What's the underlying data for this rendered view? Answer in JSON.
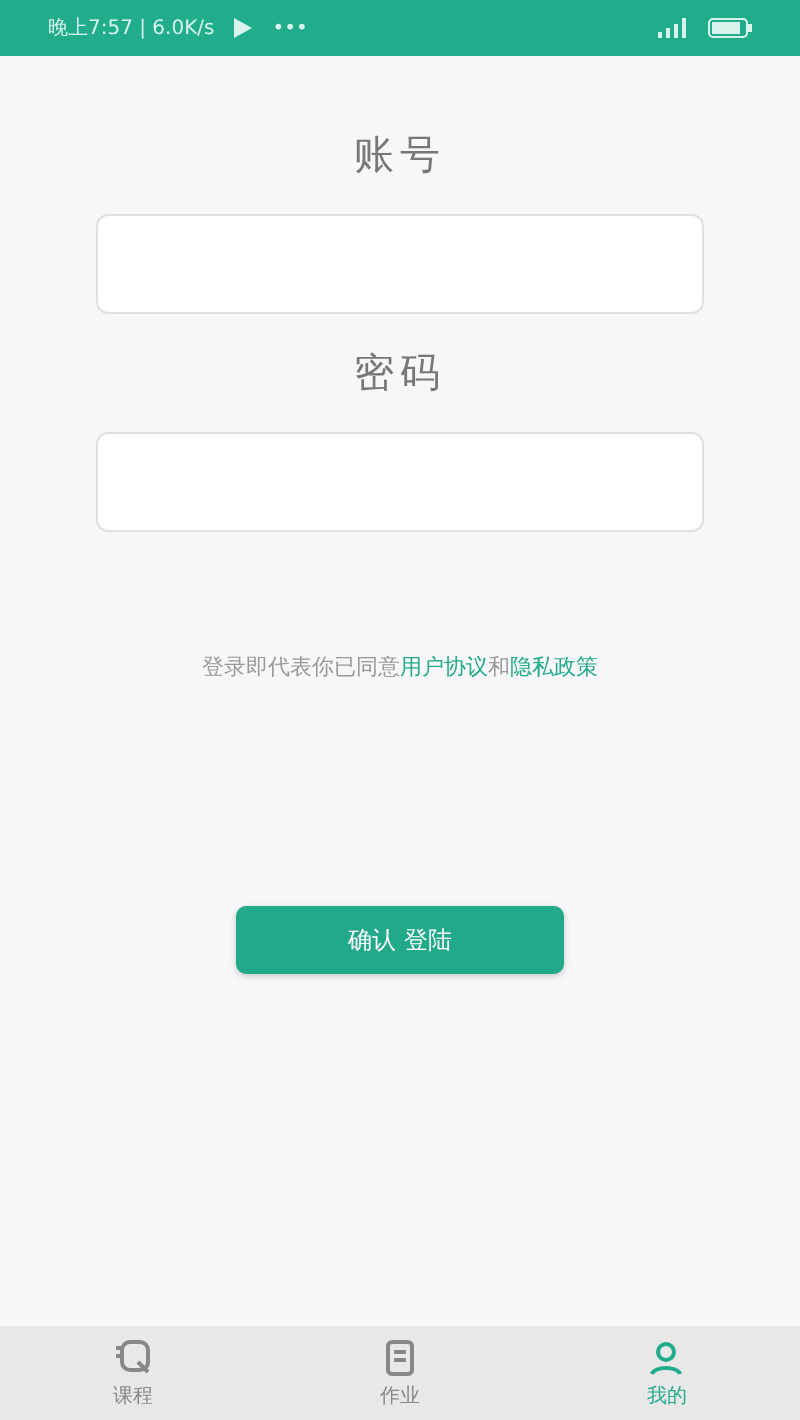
{
  "status_bar": {
    "time": "晚上7:57 | 6.0K/s",
    "more": "•••"
  },
  "form": {
    "fields": [
      {
        "label": "账号"
      },
      {
        "label": "密码"
      }
    ],
    "agreement": "登录即代表你已同意",
    "links": [
      "用户协议",
      "隐私政策"
    ],
    "conjunction": "和",
    "submit": "确认 登陆"
  },
  "tabs": [
    {
      "label": "课程",
      "selected": false
    },
    {
      "label": "作业",
      "selected": false
    },
    {
      "label": "我的",
      "selected": true
    }
  ]
}
